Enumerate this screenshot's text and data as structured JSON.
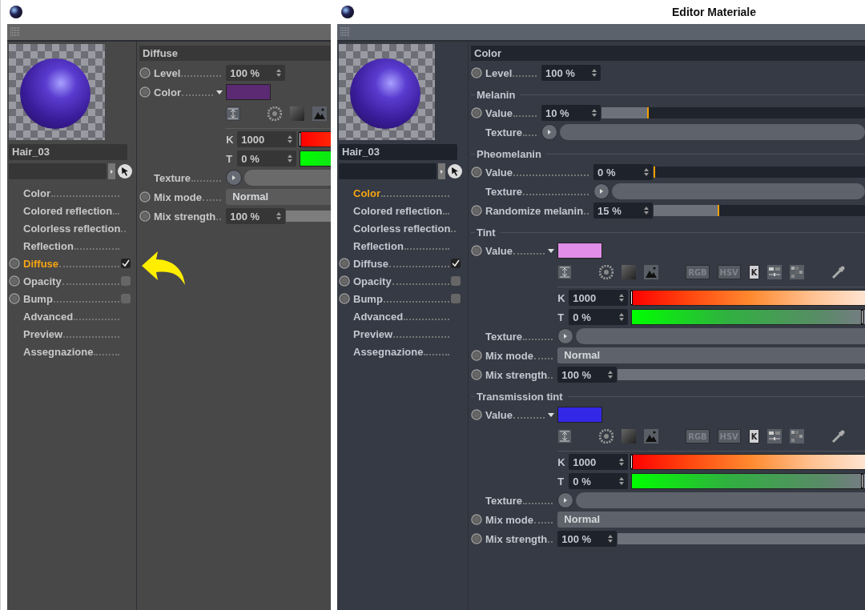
{
  "panels": [
    {
      "pointer_arrow": true,
      "material_name": "Hair_03",
      "channels": [
        {
          "label": "Color",
          "kind": "plain",
          "selected": false
        },
        {
          "label": "Colored reflection",
          "kind": "plain",
          "selected": false
        },
        {
          "label": "Colorless reflection",
          "kind": "plain",
          "selected": false
        },
        {
          "label": "Reflection",
          "kind": "plain",
          "selected": false
        },
        {
          "label": "Diffuse",
          "kind": "toggle",
          "selected": true,
          "checked": true
        },
        {
          "label": "Opacity",
          "kind": "toggle",
          "selected": false,
          "checked": false
        },
        {
          "label": "Bump",
          "kind": "toggle",
          "selected": false,
          "checked": false
        },
        {
          "label": "Advanced",
          "kind": "plain",
          "selected": false
        },
        {
          "label": "Preview",
          "kind": "plain",
          "selected": false
        },
        {
          "label": "Assegnazione",
          "kind": "plain",
          "selected": false
        }
      ],
      "sections": [
        {
          "kind": "header",
          "title": "Diffuse",
          "rows": [
            {
              "kind": "number",
              "label": "Level",
              "value": "100 %"
            },
            {
              "kind": "color",
              "label": "Color",
              "color": "#5b2a73",
              "kelvin": {
                "label": "K",
                "value": "1000",
                "level": 0
              },
              "tint": {
                "label": "T",
                "value": "0 %"
              }
            },
            {
              "kind": "texture",
              "label": "Texture"
            },
            {
              "kind": "dropdown",
              "label": "Mix mode",
              "value": "Normal"
            },
            {
              "kind": "slider",
              "label": "Mix strength",
              "value": "100 %",
              "level": 1
            }
          ]
        }
      ]
    },
    {
      "title": "Editor Materiale",
      "material_name": "Hair_03",
      "channels": [
        {
          "label": "Color",
          "kind": "plain",
          "selected": true
        },
        {
          "label": "Colored reflection",
          "kind": "plain",
          "selected": false
        },
        {
          "label": "Colorless reflection",
          "kind": "plain",
          "selected": false
        },
        {
          "label": "Reflection",
          "kind": "plain",
          "selected": false
        },
        {
          "label": "Diffuse",
          "kind": "toggle",
          "selected": false,
          "checked": true
        },
        {
          "label": "Opacity",
          "kind": "toggle",
          "selected": false,
          "checked": false
        },
        {
          "label": "Bump",
          "kind": "toggle",
          "selected": false,
          "checked": false
        },
        {
          "label": "Advanced",
          "kind": "plain",
          "selected": false
        },
        {
          "label": "Preview",
          "kind": "plain",
          "selected": false
        },
        {
          "label": "Assegnazione",
          "kind": "plain",
          "selected": false
        }
      ],
      "sections": [
        {
          "kind": "header",
          "title": "Color",
          "rows": [
            {
              "kind": "number",
              "label": "Level",
              "value": "100 %"
            }
          ]
        },
        {
          "kind": "group",
          "title": "Melanin",
          "rows": [
            {
              "kind": "slider",
              "label": "Value",
              "value": "10 %",
              "level": 0.18
            },
            {
              "kind": "texture",
              "label": "Texture"
            }
          ]
        },
        {
          "kind": "group",
          "title": "Pheomelanin",
          "rows": [
            {
              "kind": "slider",
              "label": "Value",
              "value": "0 %",
              "level": 0
            },
            {
              "kind": "texture",
              "label": "Texture"
            },
            {
              "kind": "slider",
              "label": "Randomize melanin",
              "value": "15 %",
              "level": 0.31
            }
          ]
        },
        {
          "kind": "group",
          "title": "Tint",
          "rows": [
            {
              "kind": "color",
              "label": "Value",
              "color": "#e08ee8",
              "modes": [
                {
                  "label": "RGB",
                  "selected": false
                },
                {
                  "label": "HSV",
                  "selected": false
                },
                {
                  "label": "K",
                  "selected": true
                }
              ],
              "kelvin": {
                "label": "K",
                "value": "1000",
                "level": 0
              },
              "tint": {
                "label": "T",
                "value": "0 %",
                "level": 0.967
              }
            },
            {
              "kind": "texture",
              "label": "Texture"
            },
            {
              "kind": "dropdown",
              "label": "Mix mode",
              "value": "Normal"
            },
            {
              "kind": "slider",
              "label": "Mix strength",
              "value": "100 %",
              "level": 1
            }
          ]
        },
        {
          "kind": "group",
          "title": "Transmission tint",
          "rows": [
            {
              "kind": "color",
              "label": "Value",
              "color": "#3428e8",
              "modes": [
                {
                  "label": "RGB",
                  "selected": false
                },
                {
                  "label": "HSV",
                  "selected": false
                },
                {
                  "label": "K",
                  "selected": true
                }
              ],
              "kelvin": {
                "label": "K",
                "value": "1000",
                "level": 0
              },
              "tint": {
                "label": "T",
                "value": "0 %",
                "level": 0.967
              }
            },
            {
              "kind": "texture",
              "label": "Texture"
            },
            {
              "kind": "dropdown",
              "label": "Mix mode",
              "value": "Normal"
            },
            {
              "kind": "slider",
              "label": "Mix strength",
              "value": "100 %",
              "level": 1
            }
          ]
        }
      ]
    }
  ]
}
